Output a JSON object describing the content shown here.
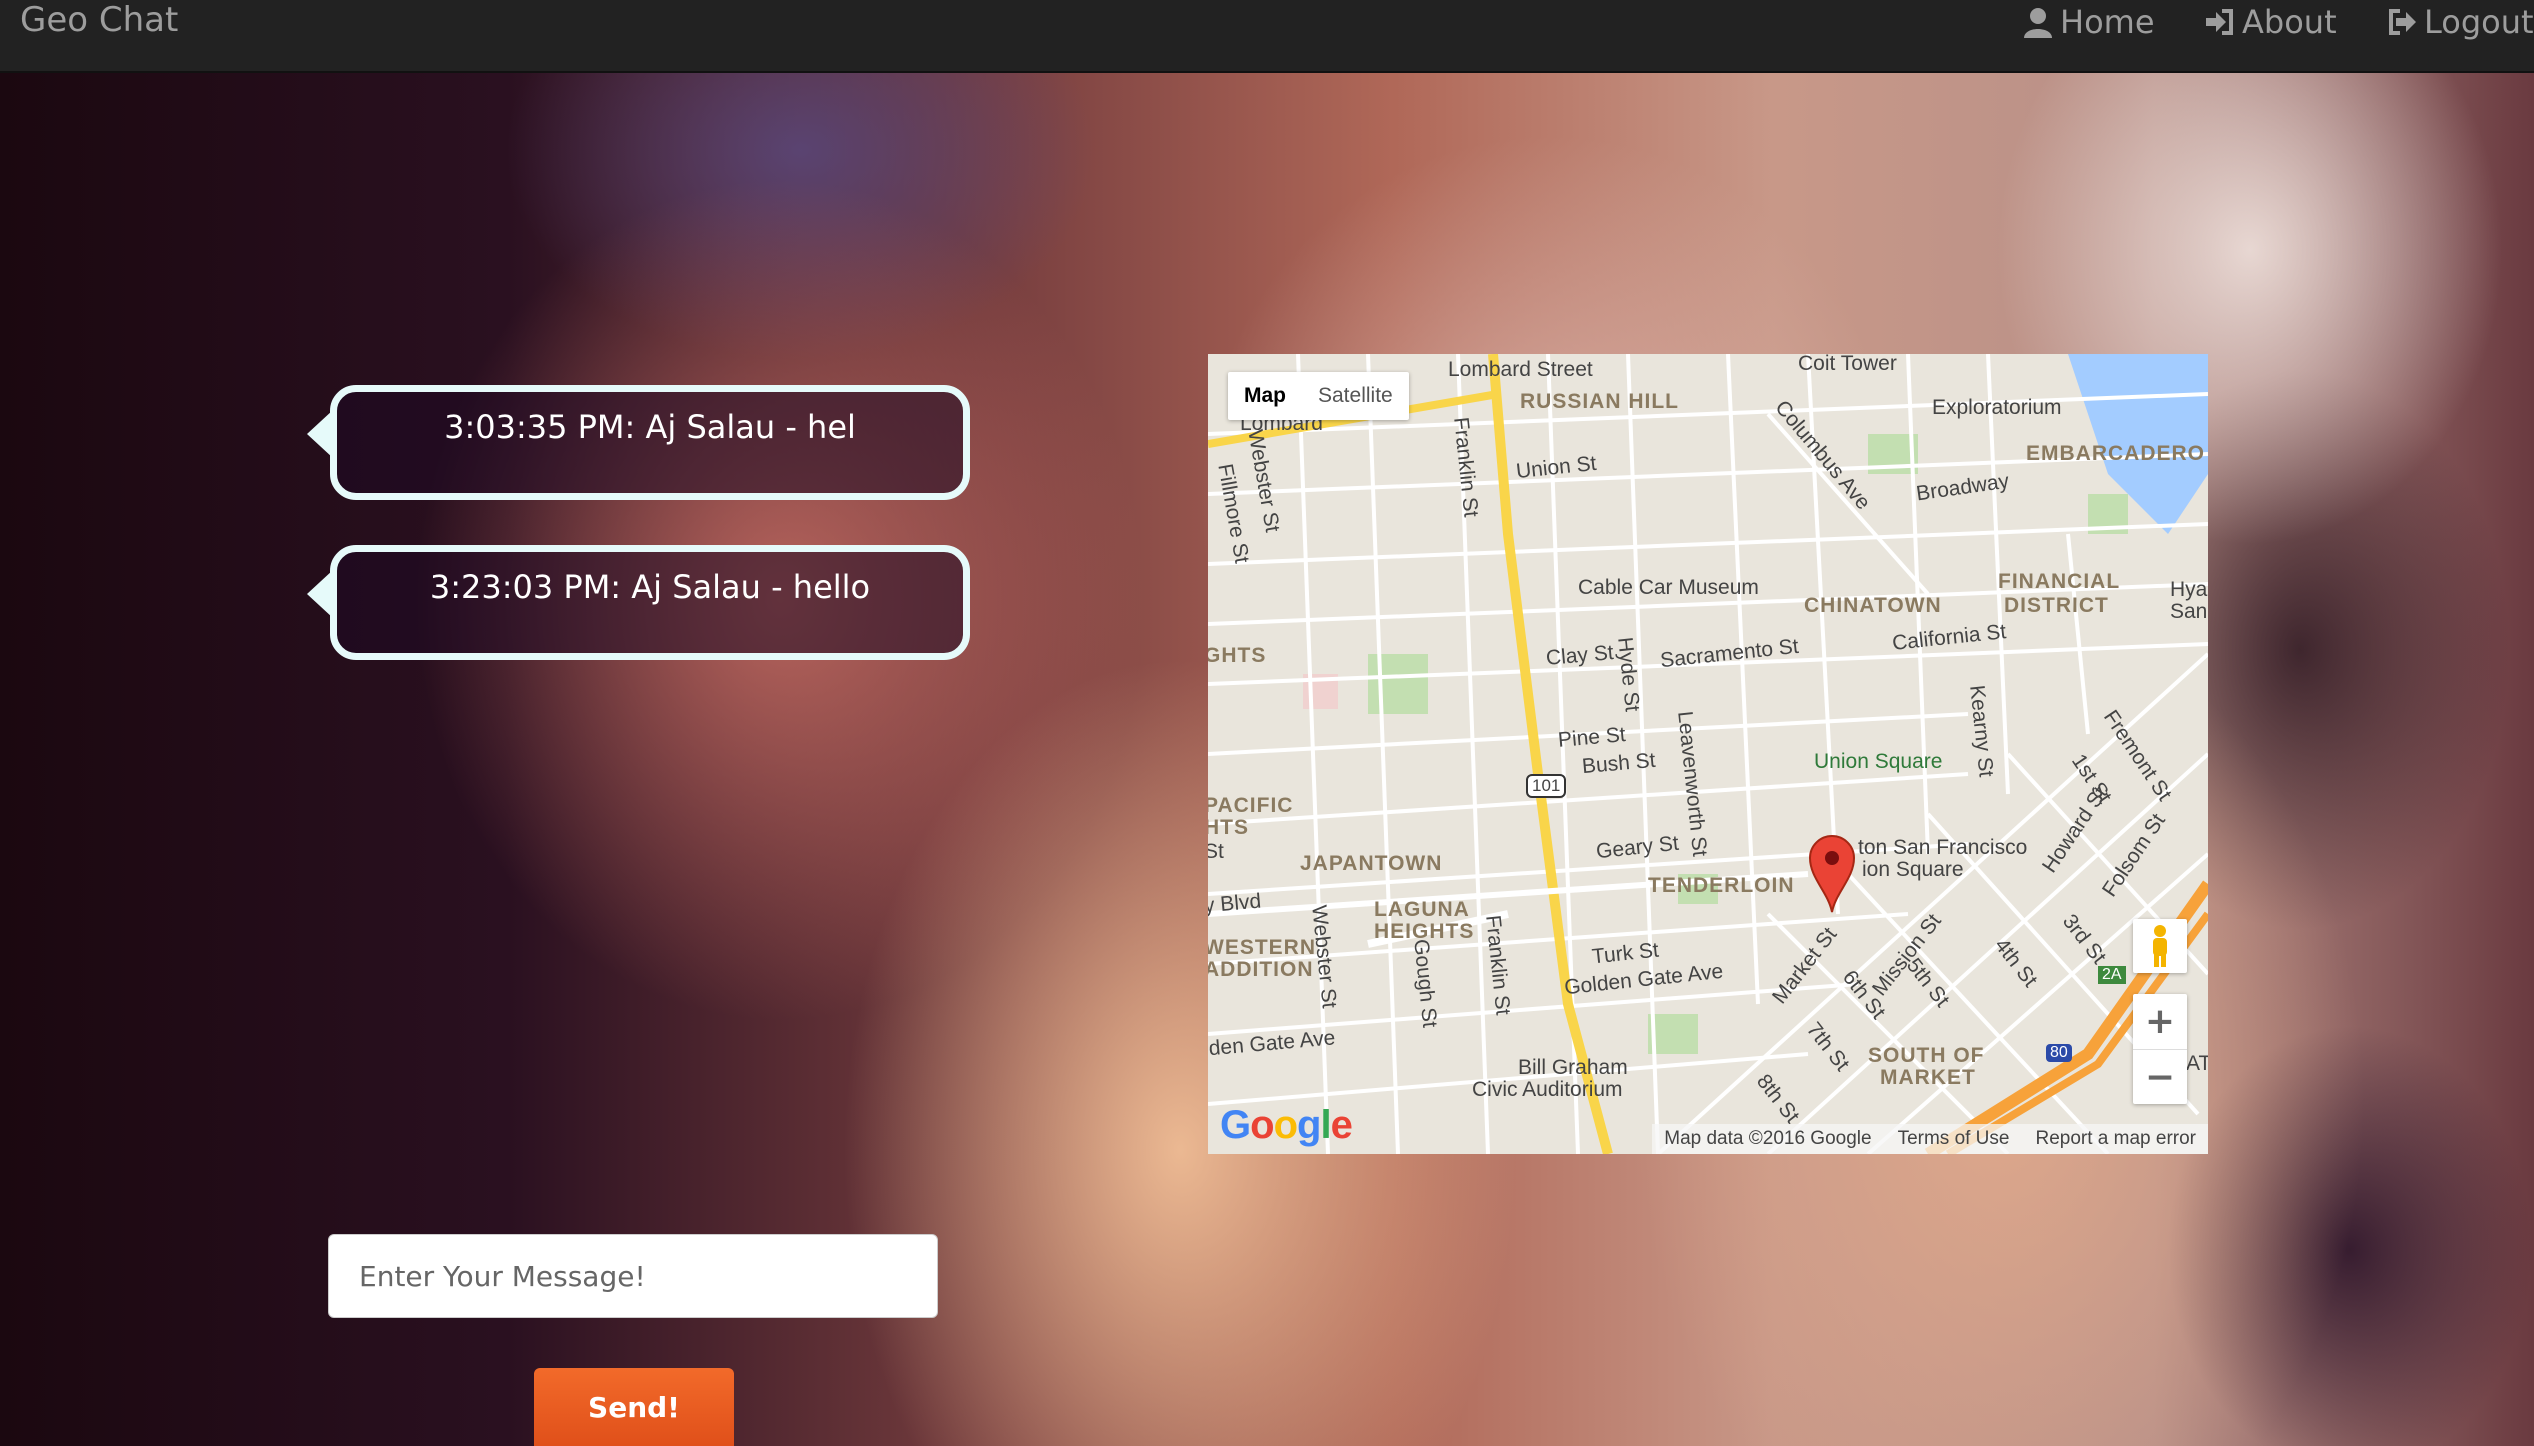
{
  "navbar": {
    "brand": "Geo Chat",
    "links": [
      {
        "label": "Home",
        "icon": "user-icon"
      },
      {
        "label": "About",
        "icon": "sign-in-icon"
      },
      {
        "label": "Logout",
        "icon": "sign-out-icon"
      }
    ]
  },
  "messages": [
    {
      "text": "3:03:35 PM: Aj Salau - hel"
    },
    {
      "text": "3:23:03 PM: Aj Salau - hello"
    }
  ],
  "map": {
    "type_controls": {
      "map": "Map",
      "satellite": "Satellite"
    },
    "labels": {
      "lombard_street": "Lombard Street",
      "coit_tower": "Coit Tower",
      "russian_hill": "RUSSIAN HILL",
      "exploratorium": "Exploratorium",
      "embarcadero": "EMBARCADERO",
      "lombard": "Lombard",
      "union_st": "Union St",
      "columbus_ave": "Columbus Ave",
      "broadway": "Broadway",
      "webster_st": "Webster St",
      "fillmore_st": "Fillmore St",
      "franklin_st": "Franklin St",
      "cable_car_museum": "Cable Car Museum",
      "chinatown": "CHINATOWN",
      "financial_district_1": "FINANCIAL",
      "financial_district_2": "DISTRICT",
      "hyatt": "Hya",
      "san": "San",
      "hts": "GHTS",
      "clay_st": "Clay St",
      "sacramento_st": "Sacramento St",
      "california_st": "California St",
      "hyde_st": "Hyde St",
      "kearny_st": "Kearny St",
      "fremont_st": "Fremont St",
      "pine_st": "Pine St",
      "bush_st": "Bush St",
      "leavenworth_st": "Leavenworth St",
      "union_square": "Union Square",
      "first_st": "1st St",
      "pacific_1": "PACIFIC",
      "pacific_2": "HTS",
      "st": "St",
      "hwy_101": "101",
      "howard_st": "Howard St",
      "folsom_st": "Folsom St",
      "japantown": "JAPANTOWN",
      "geary_st": "Geary St",
      "tenderloin": "TENDERLOIN",
      "hotel_1": "ton San Francisco",
      "hotel_2": "ion Square",
      "ellis_blvd": "y Blvd",
      "laguna_1": "LAGUNA",
      "laguna_2": "HEIGHTS",
      "western_1": "WESTERN",
      "western_2": "ADDITION",
      "turk_st": "Turk St",
      "golden_gate_ave": "Golden Gate Ave",
      "market_st": "Market St",
      "mission_st": "Mission St",
      "fifth_st": "5th St",
      "fourth_st": "4th St",
      "third_st": "3rd St",
      "sixth_st": "6th St",
      "gough_st": "Gough St",
      "golden_gate_ave_2": "lden Gate Ave",
      "seventh_st": "7th St",
      "eighth_st": "8th St",
      "soma_1": "SOUTH OF",
      "soma_2": "MARKET",
      "bill_graham_1": "Bill Graham",
      "bill_graham_2": "Civic Auditorium",
      "hwy_80": "80",
      "exit_2a": "2A",
      "at": "AT"
    },
    "footer": {
      "data": "Map data ©2016 Google",
      "terms": "Terms of Use",
      "report": "Report a map error"
    },
    "logo": "Google"
  },
  "composer": {
    "placeholder": "Enter Your Message!",
    "send_label": "Send!"
  },
  "colors": {
    "navbar": "#222222",
    "bubble_border": "#e6fafa",
    "send_button": "#ef5f22"
  }
}
